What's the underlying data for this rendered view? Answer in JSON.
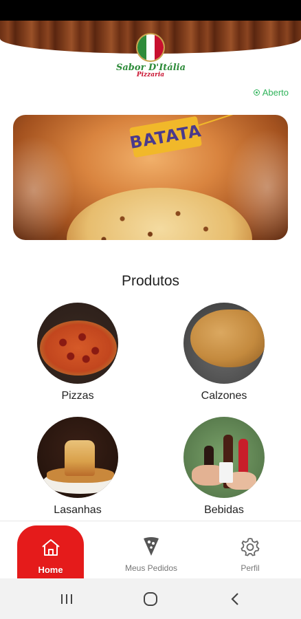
{
  "brand": {
    "name": "Sabor D'Itália",
    "subtitle": "Pizzaria",
    "colors": {
      "primary_red": "#e51b1b",
      "open_green": "#2fb35a"
    }
  },
  "status": {
    "text": "Aberto",
    "icon": "radio-dot-icon"
  },
  "banner": {
    "tag_text": "BATATA"
  },
  "products_section": {
    "title": "Produtos",
    "items": [
      {
        "label": "Pizzas",
        "icon": "pizza-photo"
      },
      {
        "label": "Calzones",
        "icon": "calzone-photo"
      },
      {
        "label": "Lasanhas",
        "icon": "lasagna-photo"
      },
      {
        "label": "Bebidas",
        "icon": "drinks-photo"
      }
    ]
  },
  "bottom_nav": {
    "items": [
      {
        "label": "Home",
        "icon": "house-icon",
        "active": true
      },
      {
        "label": "Meus Pedidos",
        "icon": "pizza-slice-icon",
        "active": false
      },
      {
        "label": "Perfil",
        "icon": "gear-icon",
        "active": false
      }
    ]
  },
  "system_nav": {
    "items": [
      "recent-apps-icon",
      "home-circle-icon",
      "back-chevron-icon"
    ]
  }
}
